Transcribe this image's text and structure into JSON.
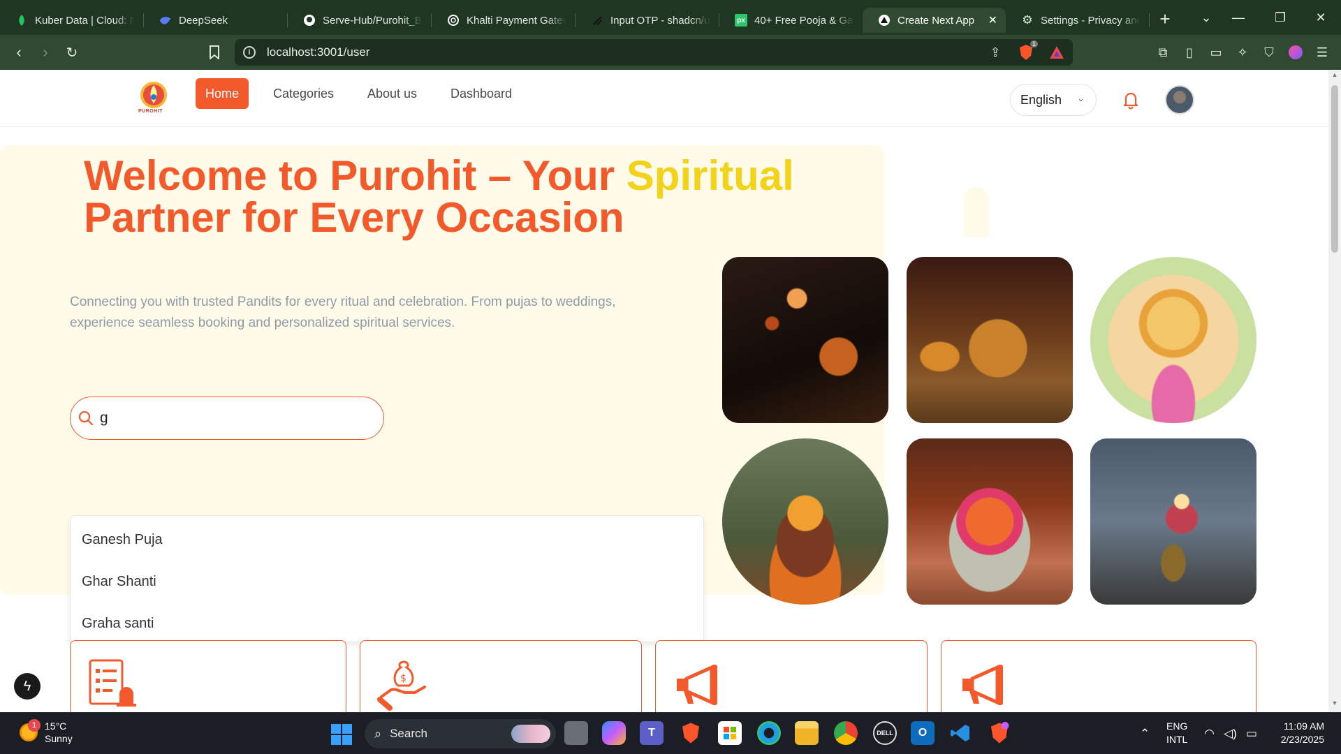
{
  "browser": {
    "tabs": [
      {
        "label": "Kuber Data | Cloud: N",
        "icon": "kuber-leaf-icon",
        "active": false
      },
      {
        "label": "DeepSeek",
        "icon": "deepseek-whale-icon",
        "active": false
      },
      {
        "label": "Serve-Hub/Purohit_B",
        "icon": "github-icon",
        "active": false
      },
      {
        "label": "Khalti Payment Gatev",
        "icon": "openai-icon",
        "active": false
      },
      {
        "label": "Input OTP - shadcn/u",
        "icon": "shadcn-icon",
        "active": false
      },
      {
        "label": "40+ Free Pooja & Ga",
        "icon": "pixabay-icon",
        "active": false
      },
      {
        "label": "Create Next App",
        "icon": "nextjs-icon",
        "active": true
      },
      {
        "label": "Settings - Privacy anc",
        "icon": "settings-gear-icon",
        "active": false
      }
    ],
    "url": "localhost:3001/user",
    "brave_badge": "1"
  },
  "navbar": {
    "logo_text": "PUROHIT",
    "links": [
      "Home",
      "Categories",
      "About us",
      "Dashboard"
    ],
    "language": "English"
  },
  "hero": {
    "title_main": "Welcome to Purohit – Your ",
    "title_highlight": "Spiritual",
    "title_end": " Partner for Every Occasion",
    "subtitle": "Connecting you with trusted Pandits for every ritual and celebration. From pujas to weddings, experience seamless booking and personalized spiritual services.",
    "search_value": "g",
    "suggestions": [
      "Ganesh Puja",
      "Ghar Shanti",
      "Graha santi"
    ]
  },
  "colors": {
    "brand": "#f2592b",
    "highlight": "#f2d21b",
    "hero_bg": "#fffbe8",
    "subtitle": "#8e9aa8"
  },
  "taskbar": {
    "weather_temp": "15°C",
    "weather_desc": "Sunny",
    "weather_badge": "1",
    "search_label": "Search",
    "lang_top": "ENG",
    "lang_bottom": "INTL",
    "time": "11:09 AM",
    "date": "2/23/2025"
  }
}
